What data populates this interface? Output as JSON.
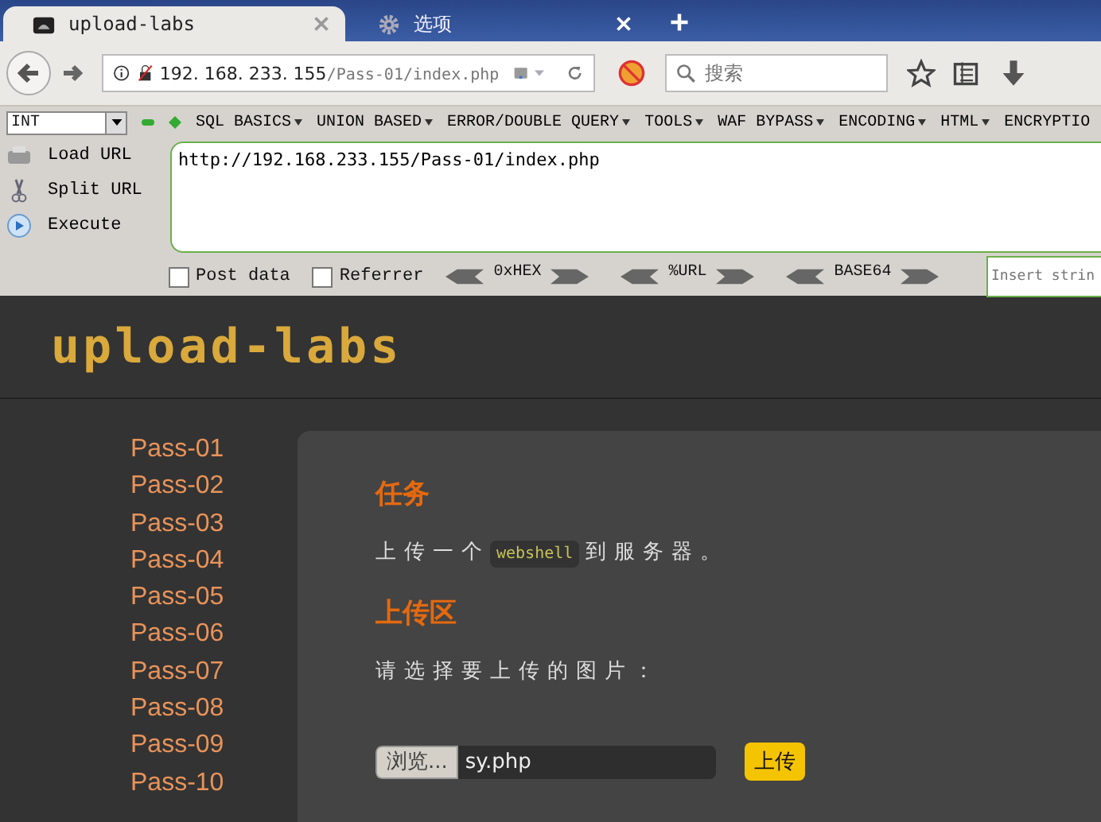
{
  "tabs": [
    {
      "title": "upload-labs",
      "selected": true
    },
    {
      "title": "选项",
      "selected": false
    }
  ],
  "address": {
    "host": "192. 168. 233. 155",
    "path": "/Pass-01/index.php"
  },
  "search": {
    "placeholder": "搜索"
  },
  "hackbar": {
    "select": "INT",
    "menus": [
      {
        "label": "SQL BASICS"
      },
      {
        "label": "UNION BASED"
      },
      {
        "label": "ERROR/DOUBLE QUERY"
      },
      {
        "label": "TOOLS"
      },
      {
        "label": "WAF BYPASS"
      },
      {
        "label": "ENCODING"
      },
      {
        "label": "HTML"
      },
      {
        "label": "ENCRYPTIO"
      }
    ],
    "actions": [
      {
        "label": "Load URL"
      },
      {
        "label": "Split URL"
      },
      {
        "label": "Execute"
      }
    ],
    "url": "http://192.168.233.155/Pass-01/index.php",
    "options": [
      {
        "label": "Post data",
        "checked": false
      },
      {
        "label": "Referrer",
        "checked": false
      }
    ],
    "encoders": [
      "0xHEX",
      "%URL",
      "BASE64"
    ],
    "insert_placeholder": "Insert strin"
  },
  "page": {
    "logo": "upload-labs",
    "passes": [
      "Pass-01",
      "Pass-02",
      "Pass-03",
      "Pass-04",
      "Pass-05",
      "Pass-06",
      "Pass-07",
      "Pass-08",
      "Pass-09",
      "Pass-10"
    ],
    "task_heading": "任务",
    "task_text": {
      "before": "上传一个",
      "code": "webshell",
      "after": "到服务器。"
    },
    "upload_heading": "上传区",
    "upload_prompt": "请选择要上传的图片：",
    "browse_button": "浏览...",
    "file_name": "sy.php",
    "upload_button": "上传"
  }
}
